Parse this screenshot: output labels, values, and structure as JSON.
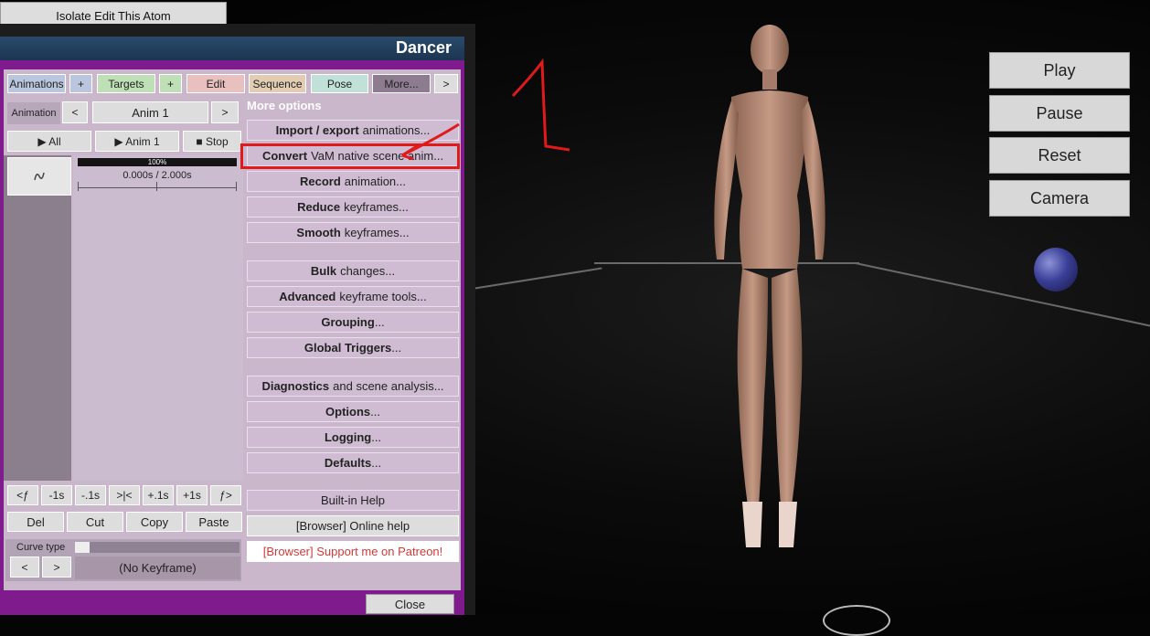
{
  "top": {
    "isolate_button": "Isolate Edit This Atom"
  },
  "panel": {
    "title": "Dancer",
    "tabs": [
      "Animations",
      "+",
      "Targets",
      "+",
      "Edit",
      "Sequence",
      "Pose",
      "More...",
      ">"
    ],
    "animation_row": {
      "label": "Animation",
      "prev": "<",
      "current": "Anim 1",
      "next": ">"
    },
    "play_row": {
      "play_all": "▶ All",
      "play_anim": "▶ Anim 1",
      "stop": "■ Stop"
    },
    "scrubber": {
      "percent_label": "100%",
      "time": "0.000s / 2.000s"
    },
    "more_options_title": "More options",
    "options": [
      {
        "bold": "Import / export",
        "rest": "animations..."
      },
      {
        "bold": "Convert",
        "rest": "VaM native scene anim..."
      },
      {
        "bold": "Record",
        "rest": "animation..."
      },
      {
        "bold": "Reduce",
        "rest": "keyframes..."
      },
      {
        "bold": "Smooth",
        "rest": "keyframes..."
      },
      {
        "bold": "Bulk",
        "rest": "changes..."
      },
      {
        "bold": "Advanced",
        "rest": "keyframe tools..."
      },
      {
        "bold": "Grouping",
        "rest": "..."
      },
      {
        "bold": "Global Triggers",
        "rest": "..."
      },
      {
        "bold": "Diagnostics",
        "rest": "and scene analysis..."
      },
      {
        "bold": "Options",
        "rest": "..."
      },
      {
        "bold": "Logging",
        "rest": "..."
      },
      {
        "bold": "Defaults",
        "rest": "..."
      }
    ],
    "help": [
      "Built-in Help",
      "[Browser] Online help",
      "[Browser] Support me on Patreon!"
    ],
    "time_buttons": [
      "<ƒ",
      "-1s",
      "-.1s",
      ">|<",
      "+.1s",
      "+1s",
      "ƒ>"
    ],
    "edit_buttons": [
      "Del",
      "Cut",
      "Copy",
      "Paste"
    ],
    "curve": {
      "label": "Curve type",
      "prev": "<",
      "next": ">",
      "keyframe": "(No Keyframe)"
    },
    "close": "Close"
  },
  "controls": [
    "Play",
    "Pause",
    "Reset",
    "Camera"
  ],
  "annotation": {
    "number": "1",
    "color": "#e01a1a"
  }
}
